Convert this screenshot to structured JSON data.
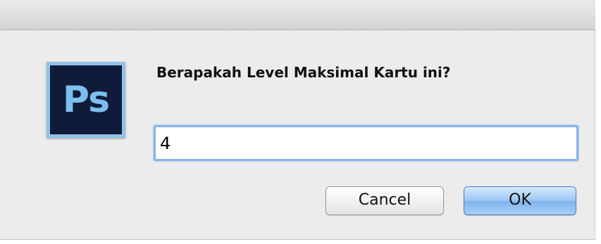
{
  "dialog": {
    "app_icon_text": "Ps",
    "prompt": "Berapakah Level Maksimal Kartu ini?",
    "input_value": "4",
    "cancel_label": "Cancel",
    "ok_label": "OK"
  },
  "colors": {
    "dialog_background": "#ececec",
    "icon_background": "#0f1b39",
    "icon_text": "#7cbfef",
    "focus_ring": "#86b4e6",
    "ok_button": "#9cc7f3"
  }
}
